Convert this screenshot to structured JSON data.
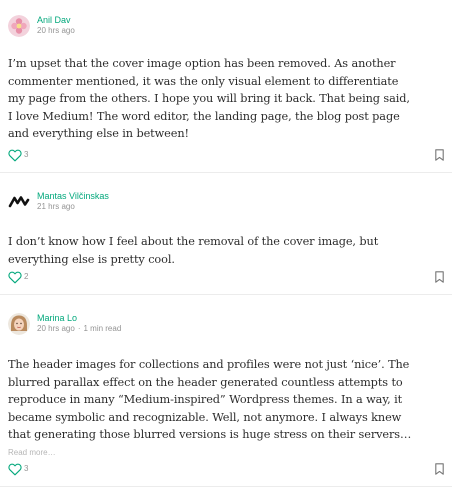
{
  "colors": {
    "accent": "#03a87c",
    "text": "#1f1f1f",
    "muted": "#8c8c8c",
    "divider": "#ececec"
  },
  "responses": [
    {
      "author": "Anil Dav",
      "avatar_icon": "avatar-flower-icon",
      "time": "20 hrs ago",
      "read_time": "",
      "body": "I’m upset that the cover image option has been removed. As another commenter mentioned, it was the only visual element to differentiate my page from the others. I hope you will bring it back. That being said, I love Medium! The word editor, the landing page, the blog post page and everything else in between!",
      "read_more": "",
      "recommend_count": "3"
    },
    {
      "author": "Mantas Vilčinskas",
      "avatar_icon": "avatar-logo-icon",
      "time": "21 hrs ago",
      "read_time": "",
      "body": "I don’t know how I feel about the removal of the cover image, but everything else is pretty cool.",
      "read_more": "",
      "recommend_count": "2"
    },
    {
      "author": "Marina Lo",
      "avatar_icon": "avatar-portrait-icon",
      "time": "20 hrs ago",
      "read_time": "1 min read",
      "body": "The header images for collections and profiles were not just ‘nice’. The blurred parallax effect on the header generated countless attempts to reproduce in many “Medium-inspired” Wordpress themes. In a way, it became symbolic and recognizable. Well, not anymore. I always knew that generating those blurred versions is huge stress on their servers…",
      "read_more": "Read more…",
      "recommend_count": "3"
    }
  ]
}
